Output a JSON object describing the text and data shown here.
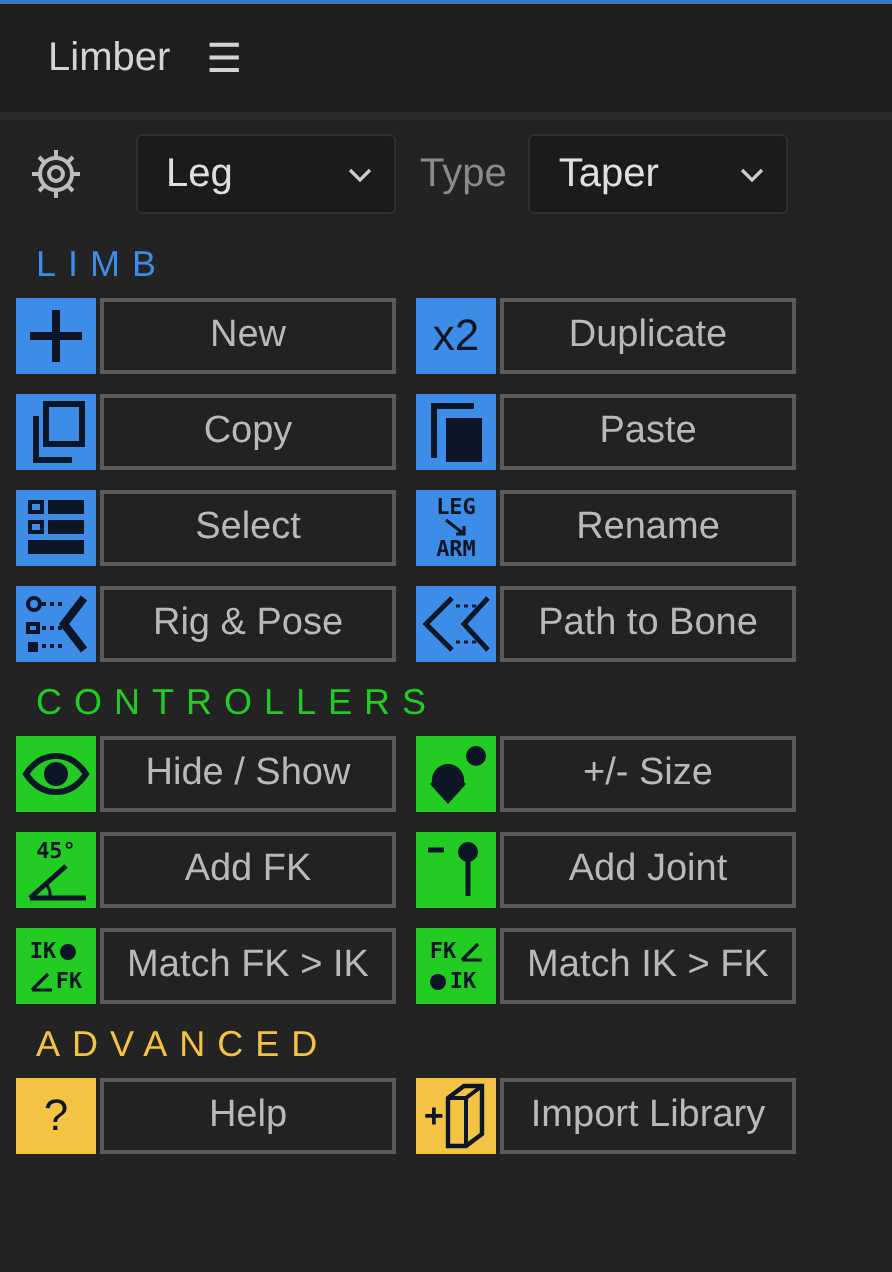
{
  "panel": {
    "title": "Limber",
    "menu_glyph": "☰"
  },
  "toolbar": {
    "limb": {
      "value": "Leg"
    },
    "type_label": "Type",
    "type": {
      "value": "Taper"
    }
  },
  "sections": [
    {
      "title": "LIMB",
      "color": "#3d8de8",
      "buttons": [
        {
          "label": "New",
          "kind": "plus"
        },
        {
          "label": "Duplicate",
          "kind": "x2",
          "glyph": [
            "x2"
          ]
        },
        {
          "label": "Copy",
          "kind": "copy"
        },
        {
          "label": "Paste",
          "kind": "paste"
        },
        {
          "label": "Select",
          "kind": "list"
        },
        {
          "label": "Rename",
          "kind": "rename",
          "glyph": [
            "LEG",
            "ARM"
          ]
        },
        {
          "label": "Rig & Pose",
          "kind": "rig"
        },
        {
          "label": "Path to Bone",
          "kind": "path"
        }
      ]
    },
    {
      "title": "CONTROLLERS",
      "color": "#22cc22",
      "buttons": [
        {
          "label": "Hide / Show",
          "kind": "eye"
        },
        {
          "label": "+/- Size",
          "kind": "dots"
        },
        {
          "label": "Add FK",
          "kind": "angle",
          "glyph": [
            "45°"
          ]
        },
        {
          "label": "Add Joint",
          "kind": "joint"
        },
        {
          "label": "Match FK > IK",
          "kind": "ikfk",
          "glyph": [
            "IK",
            "FK"
          ]
        },
        {
          "label": "Match IK > FK",
          "kind": "fkik",
          "glyph": [
            "FK",
            "IK"
          ]
        }
      ]
    },
    {
      "title": "ADVANCED",
      "color": "#f5c343",
      "buttons": [
        {
          "label": "Help",
          "kind": "help",
          "glyph": [
            "?"
          ]
        },
        {
          "label": "Import Library",
          "kind": "import",
          "glyph": [
            "+"
          ]
        }
      ]
    }
  ]
}
